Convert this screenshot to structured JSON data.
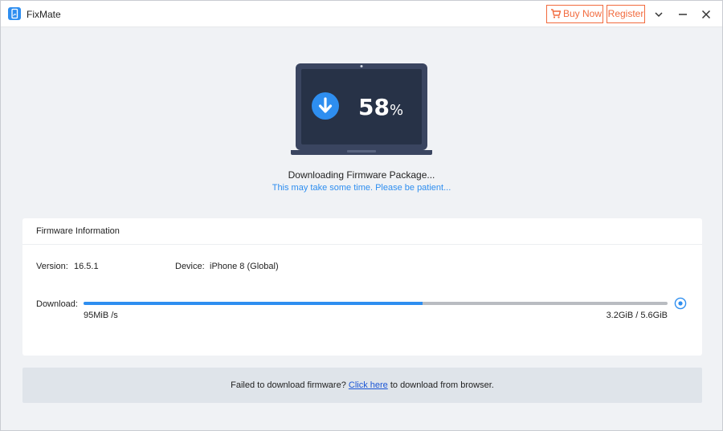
{
  "app": {
    "title": "FixMate",
    "brand_color": "#2e8ef0",
    "accent_color": "#f26a3d"
  },
  "titlebar": {
    "buy_now_label": "Buy Now",
    "register_label": "Register",
    "icons": [
      "cart-icon",
      "chevron-down-icon",
      "minimize-icon",
      "close-icon"
    ]
  },
  "progress": {
    "percent_value": "58",
    "percent_sign": "%",
    "fraction": 0.58,
    "status": "Downloading Firmware Package...",
    "hint": "This may take some time. Please be patient..."
  },
  "firmware": {
    "title": "Firmware Information",
    "version_label": "Version:",
    "version_value": "16.5.1",
    "device_label": "Device:",
    "device_value": "iPhone 8 (Global)",
    "download_label": "Download:",
    "speed": "95MiB /s",
    "size": "3.2GiB / 5.6GiB"
  },
  "footer": {
    "prefix": "Failed to download firmware? ",
    "link": "Click here",
    "suffix": " to download from browser."
  }
}
